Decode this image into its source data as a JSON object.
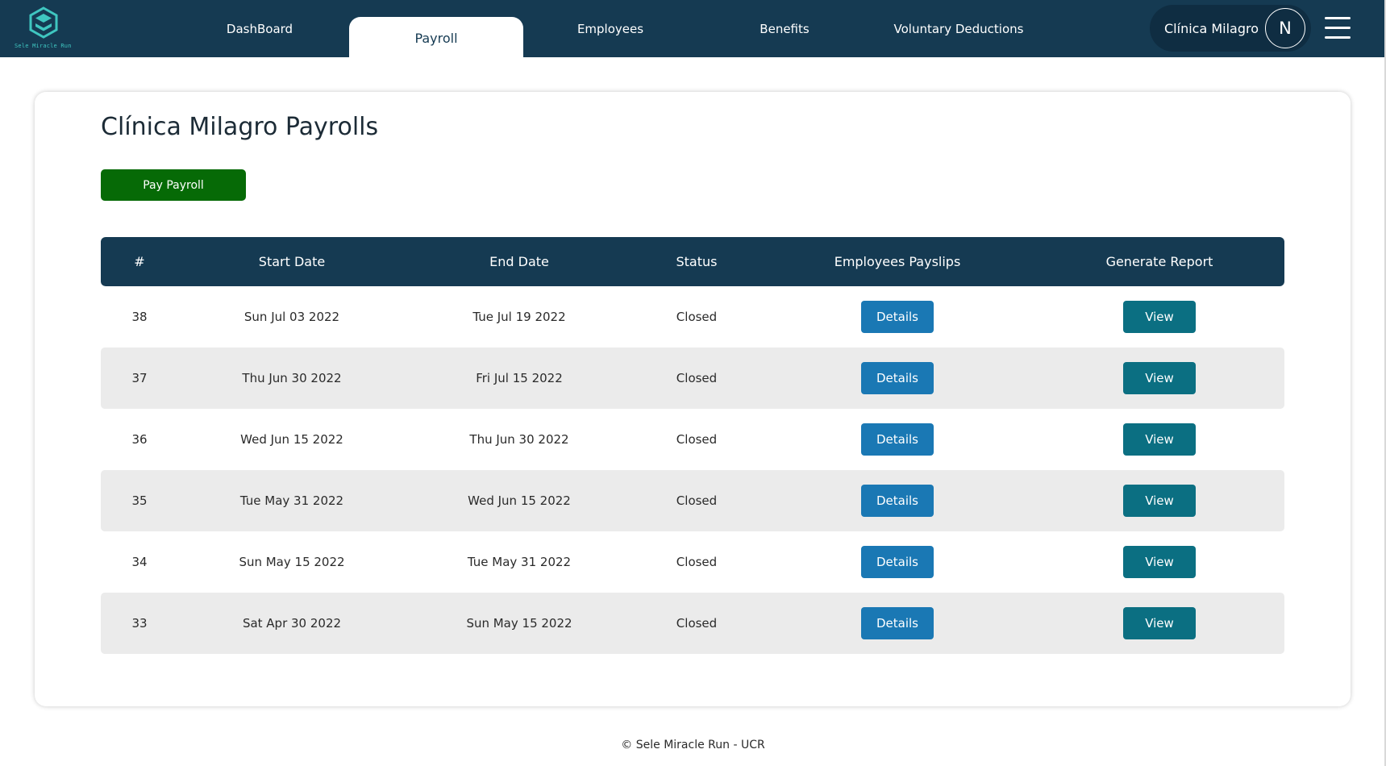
{
  "brand": {
    "name": "Sele Miracle Run",
    "logo_color": "#3fc6c0"
  },
  "nav": {
    "items": [
      {
        "label": "DashBoard",
        "active": false
      },
      {
        "label": "Payroll",
        "active": true
      },
      {
        "label": "Employees",
        "active": false
      },
      {
        "label": "Benefits",
        "active": false
      },
      {
        "label": "Voluntary Deductions",
        "active": false
      }
    ],
    "company_name": "Clínica Milagro",
    "avatar_initial": "N",
    "menu_icon": "hamburger-icon"
  },
  "main": {
    "title": "Clínica Milagro Payrolls",
    "pay_button_label": "Pay Payroll"
  },
  "table": {
    "headers": [
      "#",
      "Start Date",
      "End Date",
      "Status",
      "Employees Payslips",
      "Generate Report"
    ],
    "rows": [
      {
        "id": "38",
        "start": "Sun Jul 03 2022",
        "end": "Tue Jul 19 2022",
        "status": "Closed",
        "details": "Details",
        "view": "View"
      },
      {
        "id": "37",
        "start": "Thu Jun 30 2022",
        "end": "Fri Jul 15 2022",
        "status": "Closed",
        "details": "Details",
        "view": "View"
      },
      {
        "id": "36",
        "start": "Wed Jun 15 2022",
        "end": "Thu Jun 30 2022",
        "status": "Closed",
        "details": "Details",
        "view": "View"
      },
      {
        "id": "35",
        "start": "Tue May 31 2022",
        "end": "Wed Jun 15 2022",
        "status": "Closed",
        "details": "Details",
        "view": "View"
      },
      {
        "id": "34",
        "start": "Sun May 15 2022",
        "end": "Tue May 31 2022",
        "status": "Closed",
        "details": "Details",
        "view": "View"
      },
      {
        "id": "33",
        "start": "Sat Apr 30 2022",
        "end": "Sun May 15 2022",
        "status": "Closed",
        "details": "Details",
        "view": "View"
      }
    ]
  },
  "footer": {
    "text": "© Sele Miracle Run - UCR"
  },
  "colors": {
    "nav_bg": "#153a52",
    "pay_button": "#066a06",
    "details_button": "#1a78b4",
    "view_button": "#0b6f82",
    "row_alt": "#ebebeb"
  }
}
